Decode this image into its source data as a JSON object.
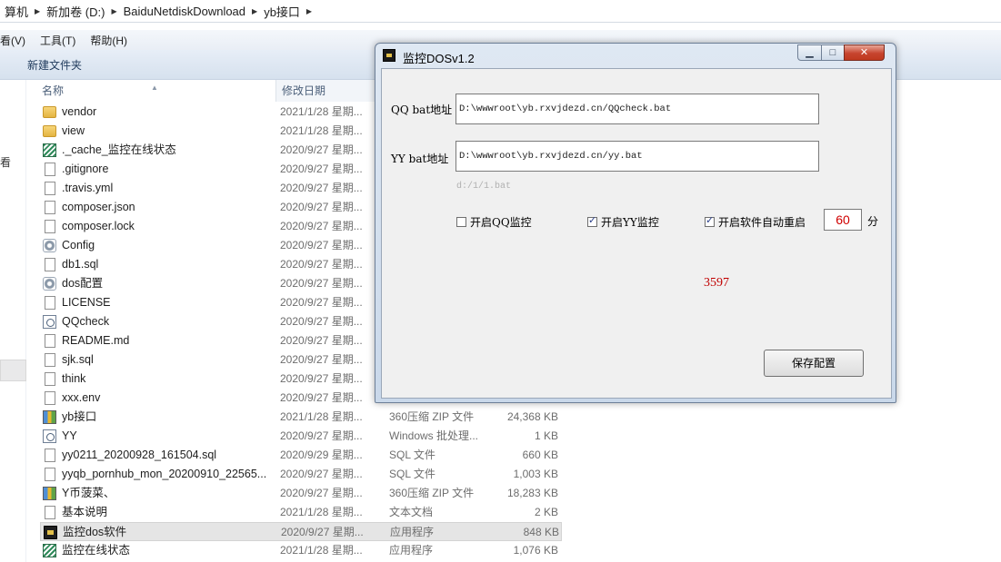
{
  "explorer": {
    "breadcrumb": [
      "算机",
      "新加卷 (D:)",
      "BaiduNetdiskDownload",
      "yb接口"
    ],
    "menu": [
      "看(V)",
      "工具(T)",
      "帮助(H)"
    ],
    "toolbar": {
      "new_folder": "新建文件夹"
    },
    "nav_fragment": "看",
    "columns": {
      "name": "名称",
      "date": "修改日期"
    },
    "files": [
      {
        "name": "vendor",
        "date": "2021/1/28 星期...",
        "type": "",
        "size": "",
        "icon": "folder-icon"
      },
      {
        "name": "view",
        "date": "2021/1/28 星期...",
        "type": "",
        "size": "",
        "icon": "folder-icon"
      },
      {
        "name": "._cache_监控在线状态",
        "date": "2020/9/27 星期...",
        "type": "",
        "size": "",
        "icon": "cache-file-icon"
      },
      {
        "name": ".gitignore",
        "date": "2020/9/27 星期...",
        "type": "",
        "size": "",
        "icon": "file-icon"
      },
      {
        "name": ".travis.yml",
        "date": "2020/9/27 星期...",
        "type": "",
        "size": "",
        "icon": "file-icon"
      },
      {
        "name": "composer.json",
        "date": "2020/9/27 星期...",
        "type": "",
        "size": "",
        "icon": "file-icon"
      },
      {
        "name": "composer.lock",
        "date": "2020/9/27 星期...",
        "type": "",
        "size": "",
        "icon": "file-icon"
      },
      {
        "name": "Config",
        "date": "2020/9/27 星期...",
        "type": "",
        "size": "",
        "icon": "settings-file-icon"
      },
      {
        "name": "db1.sql",
        "date": "2020/9/27 星期...",
        "type": "",
        "size": "",
        "icon": "file-icon"
      },
      {
        "name": "dos配置",
        "date": "2020/9/27 星期...",
        "type": "",
        "size": "",
        "icon": "settings-file-icon"
      },
      {
        "name": "LICENSE",
        "date": "2020/9/27 星期...",
        "type": "",
        "size": "",
        "icon": "file-icon"
      },
      {
        "name": "QQcheck",
        "date": "2020/9/27 星期...",
        "type": "",
        "size": "",
        "icon": "batch-file-icon"
      },
      {
        "name": "README.md",
        "date": "2020/9/27 星期...",
        "type": "",
        "size": "",
        "icon": "file-icon"
      },
      {
        "name": "sjk.sql",
        "date": "2020/9/27 星期...",
        "type": "",
        "size": "",
        "icon": "file-icon"
      },
      {
        "name": "think",
        "date": "2020/9/27 星期...",
        "type": "",
        "size": "",
        "icon": "file-icon"
      },
      {
        "name": "xxx.env",
        "date": "2020/9/27 星期...",
        "type": "",
        "size": "",
        "icon": "file-icon"
      },
      {
        "name": "yb接口",
        "date": "2021/1/28 星期...",
        "type": "360压缩 ZIP 文件",
        "size": "24,368 KB",
        "icon": "zip-archive-icon"
      },
      {
        "name": "YY",
        "date": "2020/9/27 星期...",
        "type": "Windows 批处理...",
        "size": "1 KB",
        "icon": "batch-file-icon"
      },
      {
        "name": "yy0211_20200928_161504.sql",
        "date": "2020/9/29 星期...",
        "type": "SQL 文件",
        "size": "660 KB",
        "icon": "file-icon"
      },
      {
        "name": "yyqb_pornhub_mon_20200910_22565...",
        "date": "2020/9/27 星期...",
        "type": "SQL 文件",
        "size": "1,003 KB",
        "icon": "file-icon"
      },
      {
        "name": "Y币菠菜、",
        "date": "2020/9/27 星期...",
        "type": "360压缩 ZIP 文件",
        "size": "18,283 KB",
        "icon": "zip-archive-icon"
      },
      {
        "name": "基本说明",
        "date": "2021/1/28 星期...",
        "type": "文本文档",
        "size": "2 KB",
        "icon": "file-icon"
      },
      {
        "name": "监控dos软件",
        "date": "2020/9/27 星期...",
        "type": "应用程序",
        "size": "848 KB",
        "icon": "application-icon",
        "selected": true
      },
      {
        "name": "监控在线状态",
        "date": "2021/1/28 星期...",
        "type": "应用程序",
        "size": "1,076 KB",
        "icon": "cache-file-icon"
      }
    ]
  },
  "dialog": {
    "title": "监控DOSv1.2",
    "controls": {
      "minimize": "▁",
      "maximize": "□",
      "close": "✕"
    },
    "qq_label": "QQ bat地址",
    "qq_path": "D:\\wwwroot\\yb.rxvjdezd.cn/QQcheck.bat",
    "yy_label": "YY bat地址",
    "yy_path": "D:\\wwwroot\\yb.rxvjdezd.cn/yy.bat",
    "hint": "d:/1/1.bat",
    "qq_monitor": {
      "label": "开启QQ监控",
      "checked": false
    },
    "yy_monitor": {
      "label": "开启YY监控",
      "checked": true
    },
    "auto_restart": {
      "label": "开启软件自动重启",
      "checked": true
    },
    "minutes": "60",
    "minutes_unit": "分",
    "counter": "3597",
    "save_button": "保存配置"
  }
}
